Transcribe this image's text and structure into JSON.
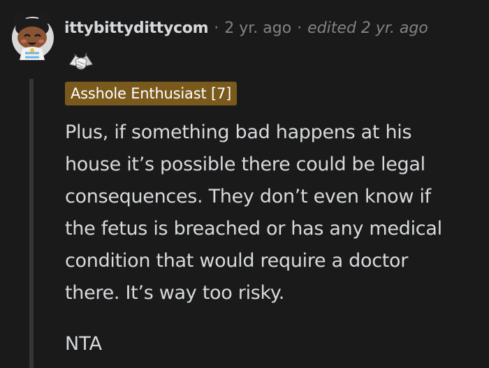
{
  "comment": {
    "username": "ittybittydittycom",
    "separator": "·",
    "age": "2 yr. ago",
    "edited": "edited 2 yr. ago",
    "avatar_icon": "snoo-avatar-icon",
    "award_icon": "handshake-award-icon",
    "flair": "Asshole Enthusiast [7]",
    "flair_color": "#7a5a1c",
    "body": "Plus, if something bad happens at his\nhouse it’s possible there could be legal\nconsequences. They don’t even know if\nthe fetus is breached or has any medical\ncondition that would require a doctor\nthere. It’s way too risky.",
    "verdict": "NTA"
  }
}
